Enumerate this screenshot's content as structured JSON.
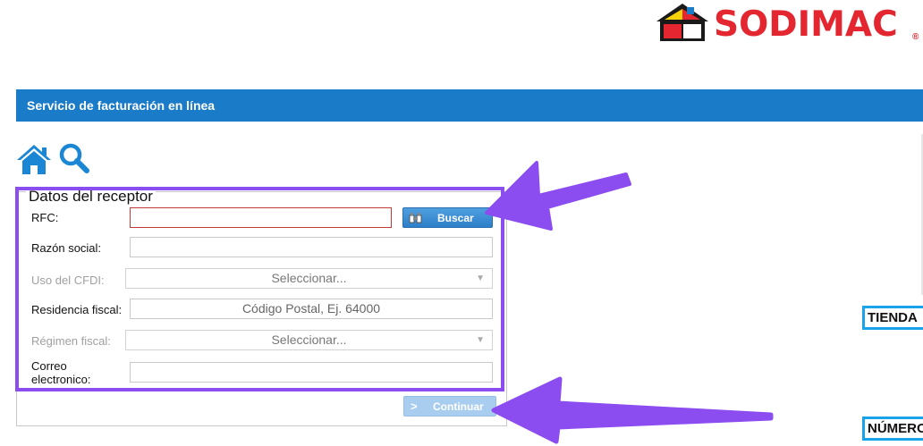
{
  "brand": {
    "name": "SODIMAC",
    "registered": "®",
    "colors": {
      "red": "#e3262f",
      "blue": "#1a7bc9"
    }
  },
  "header": {
    "title": "Servicio de facturación en línea"
  },
  "toolbar": {
    "icons": [
      "home-icon",
      "search-icon"
    ]
  },
  "form": {
    "legend": "Datos del receptor",
    "rfc": {
      "label": "RFC:",
      "value": "",
      "placeholder": ""
    },
    "buscar_label": "Buscar",
    "razon_social": {
      "label": "Razón social:",
      "value": ""
    },
    "uso_cfdi": {
      "label": "Uso del CFDI:",
      "selected": "Seleccionar..."
    },
    "residencia_fiscal": {
      "label": "Residencia fiscal:",
      "placeholder": "Código Postal, Ej. 64000"
    },
    "regimen_fiscal": {
      "label": "Régimen fiscal:",
      "selected": "Seleccionar..."
    },
    "correo": {
      "label_line1": "Correo",
      "label_line2": "electronico:",
      "value": ""
    },
    "continuar_label": "Continuar"
  },
  "side": {
    "badge_tienda": "TIENDA",
    "badge_numero": "NÚMERO"
  },
  "annotation": {
    "color": "#8b4cf0"
  }
}
